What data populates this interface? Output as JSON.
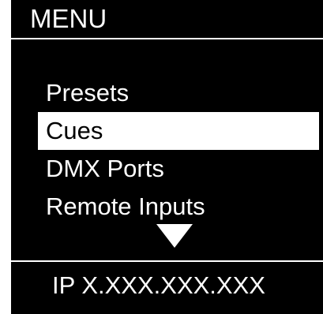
{
  "header": {
    "title": "MENU"
  },
  "menu": {
    "items": [
      {
        "label": "Presets",
        "selected": false
      },
      {
        "label": "Cues",
        "selected": true
      },
      {
        "label": "DMX Ports",
        "selected": false
      },
      {
        "label": "Remote Inputs",
        "selected": false
      }
    ],
    "scroll_indicator": "down-triangle-icon"
  },
  "footer": {
    "ip_text": "IP X.XXX.XXX.XXX"
  },
  "colors": {
    "background": "#000000",
    "foreground": "#ffffff",
    "selection_background": "#ffffff",
    "selection_text": "#000000"
  }
}
